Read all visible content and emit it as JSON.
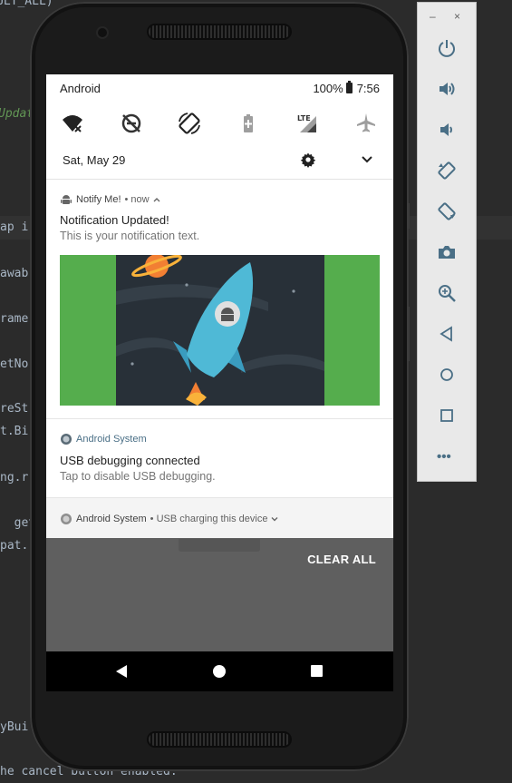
{
  "status_bar": {
    "carrier": "Android",
    "battery_percent": "100%",
    "time": "7:56"
  },
  "quick_settings": {
    "tiles": [
      "wifi-off-icon",
      "dnd-off-icon",
      "auto-rotate-icon",
      "battery-saver-icon",
      "lte-signal-icon",
      "airplane-mode-icon"
    ],
    "date": "Sat, May 29"
  },
  "notifications": [
    {
      "app": "Notify Me!",
      "meta": "• now",
      "title": "Notification Updated!",
      "text": "This is your notification text.",
      "image": "rocket-illustration"
    },
    {
      "app": "Android System",
      "title": "USB debugging connected",
      "text": "Tap to disable USB debugging."
    },
    {
      "app": "Android System",
      "meta": "• USB charging this device"
    }
  ],
  "clear_all_label": "CLEAR ALL",
  "nav_bar": [
    "back-icon",
    "home-icon",
    "recents-icon"
  ],
  "emulator_toolbar": {
    "window_buttons": [
      "–",
      "×"
    ],
    "buttons": [
      "power-icon",
      "volume-up-icon",
      "volume-down-icon",
      "rotate-left-icon",
      "rotate-right-icon",
      "screenshot-icon",
      "zoom-icon",
      "back-icon",
      "home-icon",
      "overview-icon"
    ],
    "more_label": "•••"
  },
  "background_code": [
    "ULT_ALL)",
    "Updat",
    "ap i",
    "awab",
    "rame",
    "etNo",
    "reSt",
    "t.Bi",
    "ng.r",
    "  get",
    "pat.",
    "yBui",
    "he cancel button enabled."
  ],
  "colors": {
    "accent_green": "#55ad4d",
    "rocket_bg": "#283038",
    "rocket_body": "#4fb9d6",
    "planet": "#f27f33"
  }
}
